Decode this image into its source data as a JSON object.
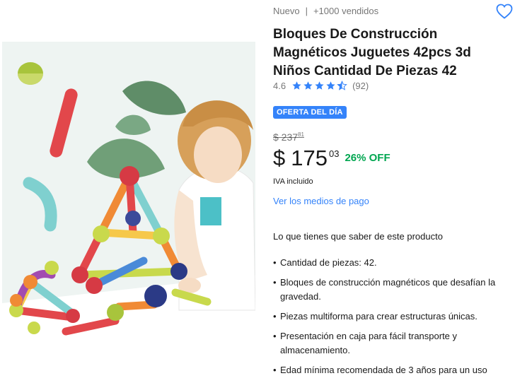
{
  "product": {
    "condition": "Nuevo",
    "separator": "|",
    "sold": "+1000 vendidos",
    "title": "Bloques De Construcción Magnéticos Juguetes 42pcs 3d Niños Cantidad De Piezas 42",
    "rating_value": "4.6",
    "rating_stars": 4.5,
    "rating_count": "(92)",
    "deal_badge": "OFERTA DEL DÍA",
    "old_price": "$ 237",
    "old_price_cents": "81",
    "currency": "$",
    "price_integer": "175",
    "price_cents": "03",
    "discount": "26% OFF",
    "tax_note": "IVA incluido",
    "payment_link": "Ver los medios de pago"
  },
  "features": {
    "title": "Lo que tienes que saber de este producto",
    "items": [
      "Cantidad de piezas: 42.",
      "Bloques de construcción magnéticos que desafían la gravedad.",
      "Piezas multiforma para crear estructuras únicas.",
      "Presentación en caja para fácil transporte y almacenamiento.",
      "Edad mínima recomendada de 3 años para un uso"
    ]
  },
  "icons": {
    "favorite": "heart-outline-icon",
    "star": "star-icon"
  },
  "colors": {
    "accent": "#3483fa",
    "discount": "#00a650"
  }
}
